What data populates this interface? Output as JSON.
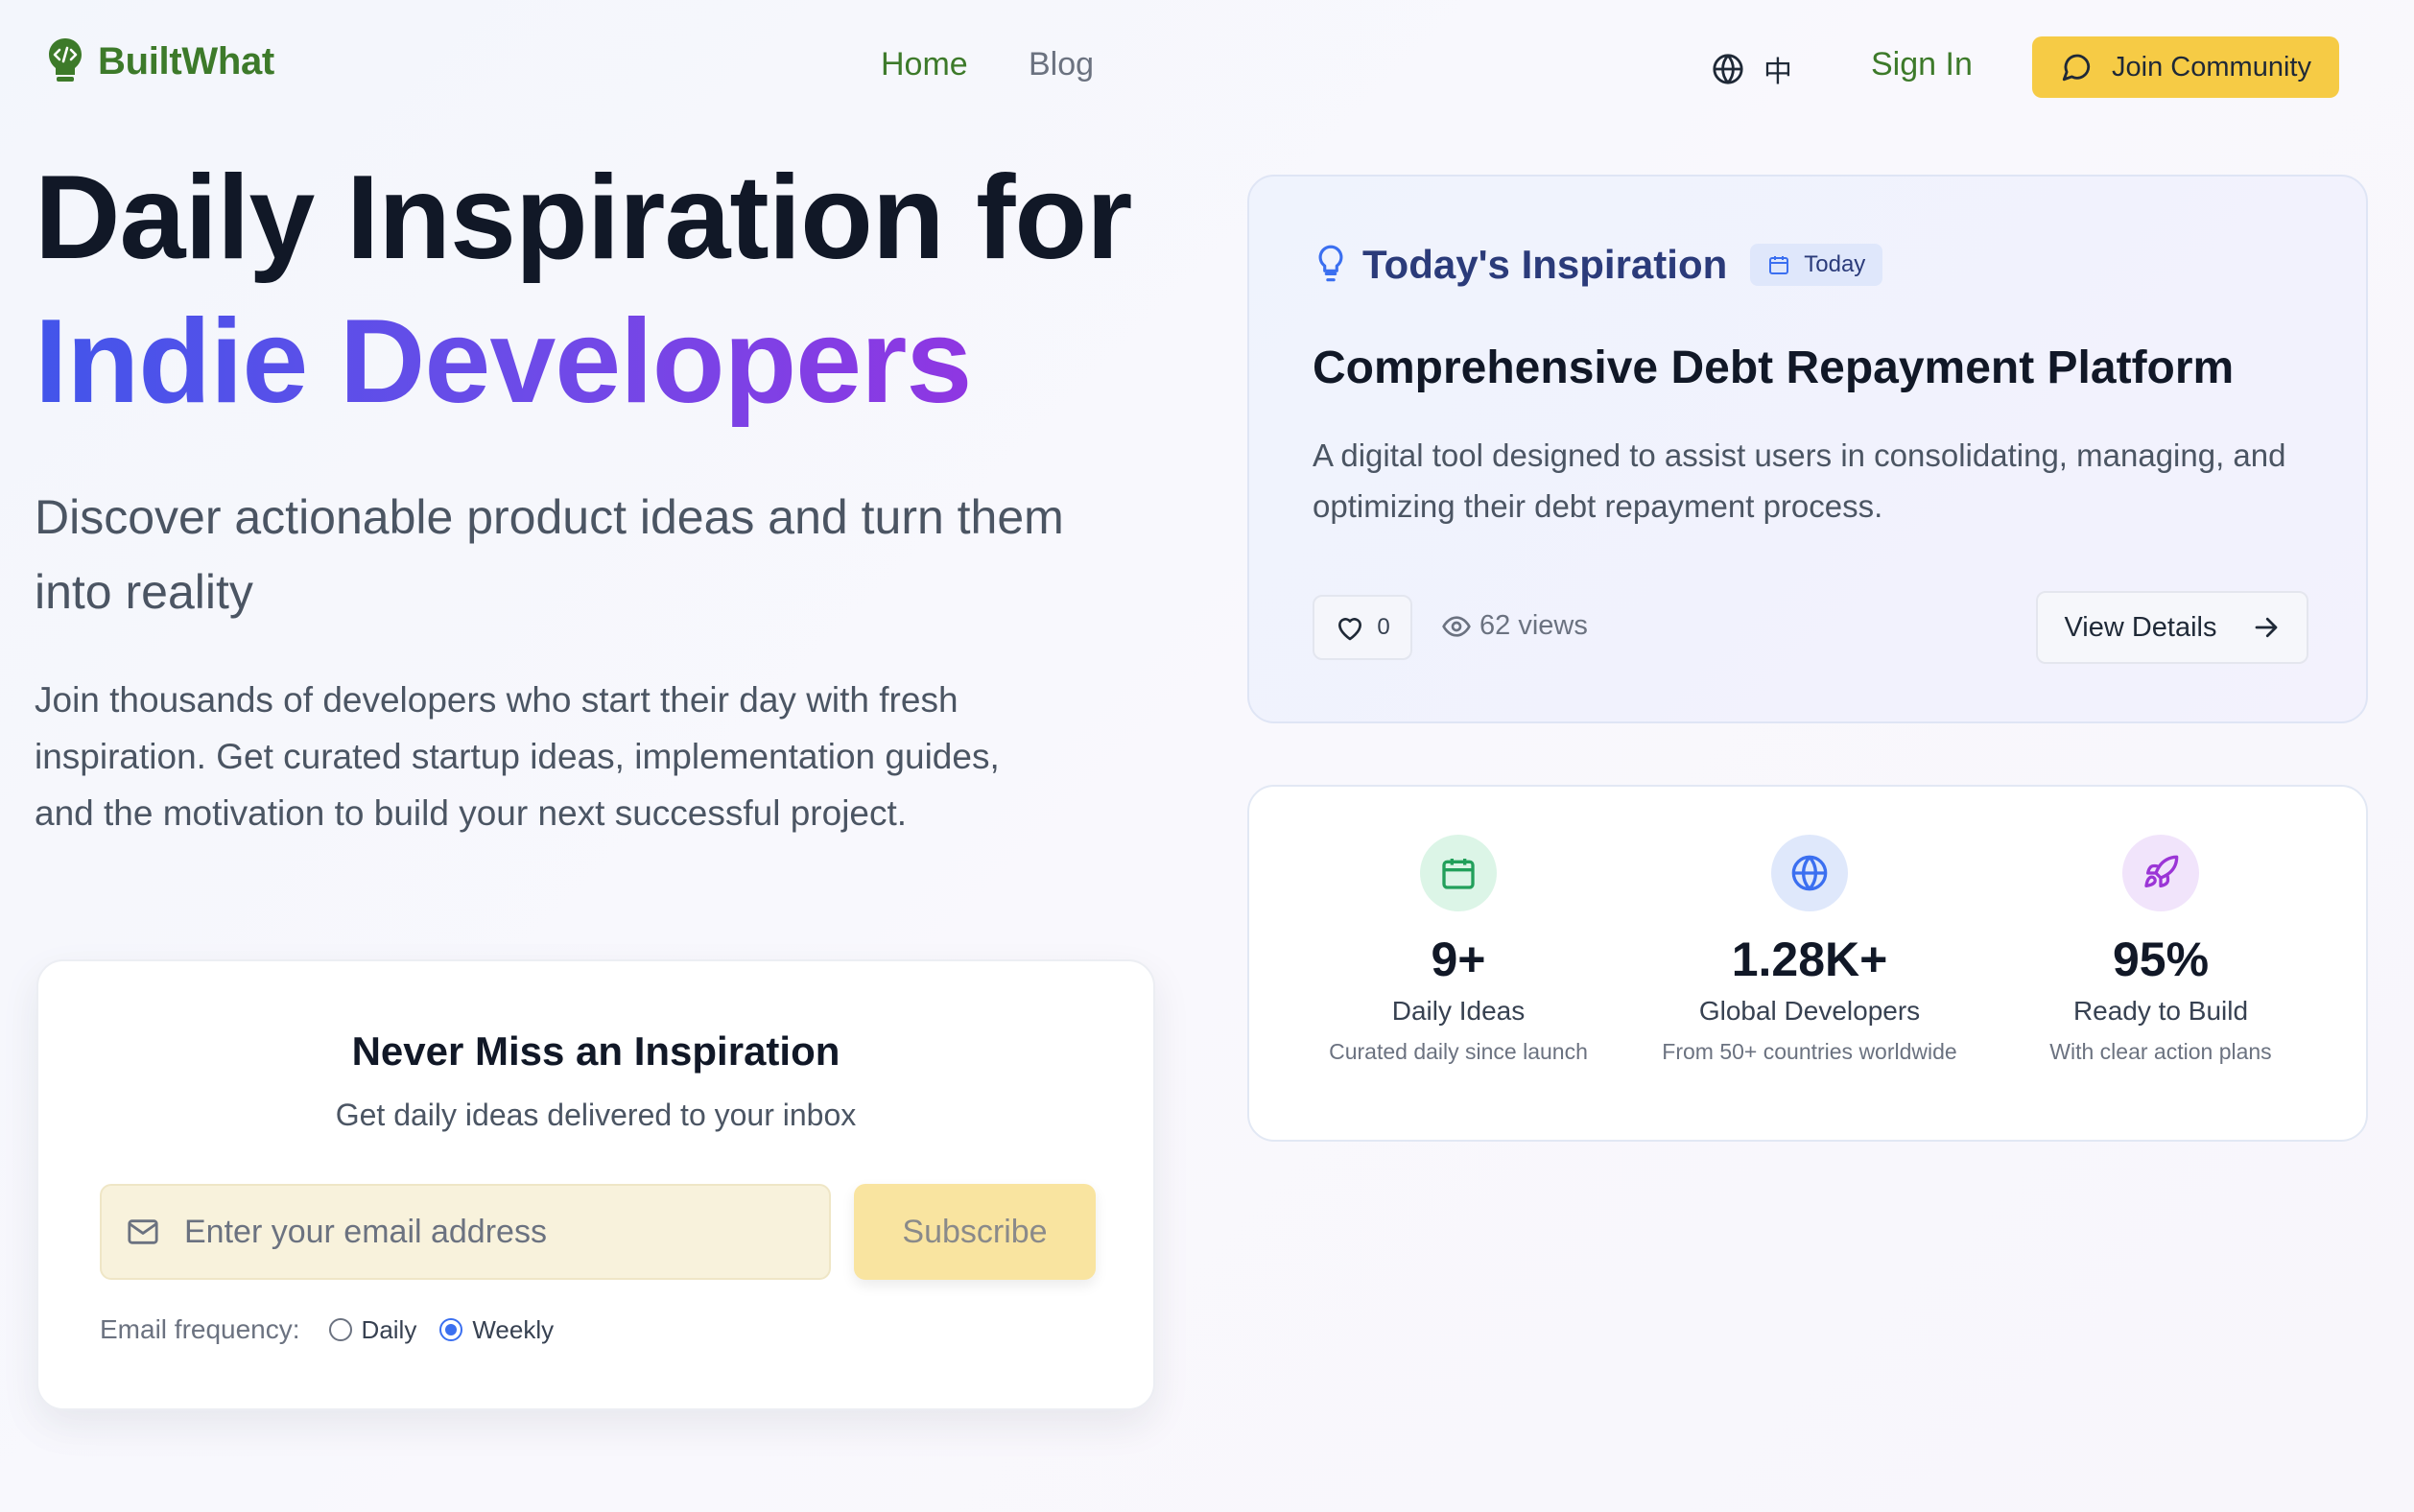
{
  "header": {
    "brand": "BuiltWhat",
    "nav": {
      "home": "Home",
      "blog": "Blog"
    },
    "language": "中",
    "sign_in": "Sign In",
    "join_community": "Join Community"
  },
  "hero": {
    "title_line1": "Daily Inspiration for",
    "title_line2": "Indie Developers",
    "subtitle": "Discover actionable product ideas and turn them into reality",
    "description": "Join thousands of developers who start their day with fresh inspiration. Get curated startup ideas, implementation guides, and the motivation to build your next successful project."
  },
  "subscribe": {
    "title": "Never Miss an Inspiration",
    "text": "Get daily ideas delivered to your inbox",
    "email_placeholder": "Enter your email address",
    "email_value": "",
    "button": "Subscribe",
    "frequency_label": "Email frequency:",
    "options": [
      "Daily",
      "Weekly"
    ],
    "selected": "Weekly"
  },
  "inspiration": {
    "heading": "Today's Inspiration",
    "badge": "Today",
    "title": "Comprehensive Debt Repayment Platform",
    "description": "A digital tool designed to assist users in consolidating, managing, and optimizing their debt repayment process.",
    "likes": "0",
    "views": "62 views",
    "details_button": "View Details"
  },
  "stats": [
    {
      "icon": "calendar-icon",
      "value": "9+",
      "label": "Daily Ideas",
      "note": "Curated daily since launch",
      "bg": "#dcf5e7",
      "color": "#22a05b"
    },
    {
      "icon": "globe-icon",
      "value": "1.28K+",
      "label": "Global Developers",
      "note": "From 50+ countries worldwide",
      "bg": "#dfe8fb",
      "color": "#3b6ff0"
    },
    {
      "icon": "rocket-icon",
      "value": "95%",
      "label": "Ready to Build",
      "note": "With clear action plans",
      "bg": "#f1e4fb",
      "color": "#9b35d6"
    }
  ],
  "colors": {
    "brand_green": "#3d7a2a",
    "accent_yellow": "#f6cb45",
    "gradient_start": "#4255ea",
    "gradient_end": "#9b2fe0"
  }
}
